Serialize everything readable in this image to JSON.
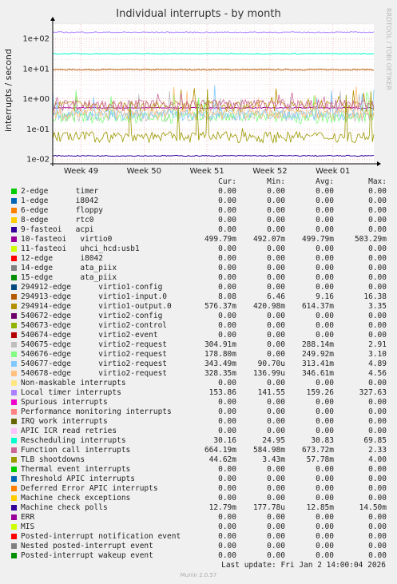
{
  "chart_data": {
    "type": "line",
    "title": "Individual interrupts - by month",
    "ylabel": "interrupts / second",
    "yscale": "log",
    "ylim": [
      0.007,
      300
    ],
    "yticks": [
      "1e-02",
      "1e-01",
      "1e+00",
      "1e+01",
      "1e+02"
    ],
    "x_ticks": [
      "Week 49",
      "Week 50",
      "Week 51",
      "Week 52",
      "Week 01"
    ],
    "grid": true,
    "columns": [
      "Cur:",
      "Min:",
      "Avg:",
      "Max:"
    ],
    "series": [
      {
        "name": "2-edge      timer",
        "color": "#00cc00",
        "cur": "0.00",
        "min": "0.00",
        "avg": "0.00",
        "max": "0.00"
      },
      {
        "name": "1-edge      i8042",
        "color": "#0066b3",
        "cur": "0.00",
        "min": "0.00",
        "avg": "0.00",
        "max": "0.00"
      },
      {
        "name": "6-edge      floppy",
        "color": "#ff8000",
        "cur": "0.00",
        "min": "0.00",
        "avg": "0.00",
        "max": "0.00"
      },
      {
        "name": "8-edge      rtc0",
        "color": "#ffcc00",
        "cur": "0.00",
        "min": "0.00",
        "avg": "0.00",
        "max": "0.00"
      },
      {
        "name": "9-fasteoi   acpi",
        "color": "#330099",
        "cur": "0.00",
        "min": "0.00",
        "avg": "0.00",
        "max": "0.00"
      },
      {
        "name": "10-fasteoi   virtio0",
        "color": "#990099",
        "cur": "499.79m",
        "min": "492.07m",
        "avg": "499.79m",
        "max": "503.29m"
      },
      {
        "name": "11-fasteoi   uhci_hcd:usb1",
        "color": "#ccff00",
        "cur": "0.00",
        "min": "0.00",
        "avg": "0.00",
        "max": "0.00"
      },
      {
        "name": "12-edge      i8042",
        "color": "#ff0000",
        "cur": "0.00",
        "min": "0.00",
        "avg": "0.00",
        "max": "0.00"
      },
      {
        "name": "14-edge      ata_piix",
        "color": "#808080",
        "cur": "0.00",
        "min": "0.00",
        "avg": "0.00",
        "max": "0.00"
      },
      {
        "name": "15-edge      ata_piix",
        "color": "#008f00",
        "cur": "0.00",
        "min": "0.00",
        "avg": "0.00",
        "max": "0.00"
      },
      {
        "name": "294912-edge      virtio1-config",
        "color": "#00487d",
        "cur": "0.00",
        "min": "0.00",
        "avg": "0.00",
        "max": "0.00"
      },
      {
        "name": "294913-edge      virtio1-input.0",
        "color": "#b35a00",
        "cur": "8.08",
        "min": "6.46",
        "avg": "9.16",
        "max": "16.38"
      },
      {
        "name": "294914-edge      virtio1-output.0",
        "color": "#b38f00",
        "cur": "576.37m",
        "min": "420.98m",
        "avg": "614.37m",
        "max": "3.35"
      },
      {
        "name": "540672-edge      virtio2-config",
        "color": "#6b006b",
        "cur": "0.00",
        "min": "0.00",
        "avg": "0.00",
        "max": "0.00"
      },
      {
        "name": "540673-edge      virtio2-control",
        "color": "#8fb300",
        "cur": "0.00",
        "min": "0.00",
        "avg": "0.00",
        "max": "0.00"
      },
      {
        "name": "540674-edge      virtio2-event",
        "color": "#b30000",
        "cur": "0.00",
        "min": "0.00",
        "avg": "0.00",
        "max": "0.00"
      },
      {
        "name": "540675-edge      virtio2-request",
        "color": "#bebebe",
        "cur": "304.91m",
        "min": "0.00",
        "avg": "288.14m",
        "max": "2.91"
      },
      {
        "name": "540676-edge      virtio2-request",
        "color": "#80ff80",
        "cur": "178.80m",
        "min": "0.00",
        "avg": "249.92m",
        "max": "3.10"
      },
      {
        "name": "540677-edge      virtio2-request",
        "color": "#80c9ff",
        "cur": "343.49m",
        "min": "90.70u",
        "avg": "313.41m",
        "max": "4.89"
      },
      {
        "name": "540678-edge      virtio2-request",
        "color": "#ffc080",
        "cur": "328.35m",
        "min": "136.99u",
        "avg": "346.61m",
        "max": "4.56"
      },
      {
        "name": "Non-maskable interrupts",
        "color": "#ffe680",
        "cur": "0.00",
        "min": "0.00",
        "avg": "0.00",
        "max": "0.00"
      },
      {
        "name": "Local timer interrupts",
        "color": "#aa80ff",
        "cur": "153.86",
        "min": "141.55",
        "avg": "159.26",
        "max": "327.63"
      },
      {
        "name": "Spurious interrupts",
        "color": "#ee00cc",
        "cur": "0.00",
        "min": "0.00",
        "avg": "0.00",
        "max": "0.00"
      },
      {
        "name": "Performance monitoring interrupts",
        "color": "#ff8080",
        "cur": "0.00",
        "min": "0.00",
        "avg": "0.00",
        "max": "0.00"
      },
      {
        "name": "IRQ work interrupts",
        "color": "#666600",
        "cur": "0.00",
        "min": "0.00",
        "avg": "0.00",
        "max": "0.00"
      },
      {
        "name": "APIC ICR read retries",
        "color": "#ffbfff",
        "cur": "0.00",
        "min": "0.00",
        "avg": "0.00",
        "max": "0.00"
      },
      {
        "name": "Rescheduling interrupts",
        "color": "#00ffcc",
        "cur": "30.16",
        "min": "24.95",
        "avg": "30.83",
        "max": "69.85"
      },
      {
        "name": "Function call interrupts",
        "color": "#cc6699",
        "cur": "664.19m",
        "min": "584.98m",
        "avg": "673.72m",
        "max": "2.33"
      },
      {
        "name": "TLB shootdowns",
        "color": "#999900",
        "cur": "44.62m",
        "min": "3.43m",
        "avg": "57.78m",
        "max": "4.00"
      },
      {
        "name": "Thermal event interrupts",
        "color": "#00cc00",
        "cur": "0.00",
        "min": "0.00",
        "avg": "0.00",
        "max": "0.00"
      },
      {
        "name": "Threshold APIC interrupts",
        "color": "#0066b3",
        "cur": "0.00",
        "min": "0.00",
        "avg": "0.00",
        "max": "0.00"
      },
      {
        "name": "Deferred Error APIC interrupts",
        "color": "#ff8000",
        "cur": "0.00",
        "min": "0.00",
        "avg": "0.00",
        "max": "0.00"
      },
      {
        "name": "Machine check exceptions",
        "color": "#ffcc00",
        "cur": "0.00",
        "min": "0.00",
        "avg": "0.00",
        "max": "0.00"
      },
      {
        "name": "Machine check polls",
        "color": "#330099",
        "cur": "12.79m",
        "min": "177.78u",
        "avg": "12.85m",
        "max": "14.50m"
      },
      {
        "name": "ERR",
        "color": "#990099",
        "cur": "0.00",
        "min": "0.00",
        "avg": "0.00",
        "max": "0.00"
      },
      {
        "name": "MIS",
        "color": "#ccff00",
        "cur": "0.00",
        "min": "0.00",
        "avg": "0.00",
        "max": "0.00"
      },
      {
        "name": "Posted-interrupt notification event",
        "color": "#ff0000",
        "cur": "0.00",
        "min": "0.00",
        "avg": "0.00",
        "max": "0.00"
      },
      {
        "name": "Nested posted-interrupt event",
        "color": "#808080",
        "cur": "0.00",
        "min": "0.00",
        "avg": "0.00",
        "max": "0.00"
      },
      {
        "name": "Posted-interrupt wakeup event",
        "color": "#008f00",
        "cur": "0.00",
        "min": "0.00",
        "avg": "0.00",
        "max": "0.00"
      }
    ]
  },
  "footer": {
    "last_update": "Last update: Fri Jan  2 14:00:04 2026",
    "munin": "Munin 2.0.57",
    "watermark": "RRDTOOL / TOBI OETIKER"
  }
}
